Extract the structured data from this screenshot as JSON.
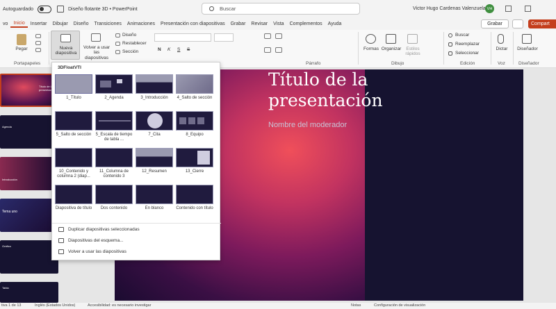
{
  "titlebar": {
    "autosave_label": "Autoguardado",
    "doc_name": "Diseño flotante 3D  •  PowerPoint",
    "search_placeholder": "Buscar",
    "user_name": "Victor Hugo Cardenas Valenzuela",
    "user_initials": "VH"
  },
  "tabs": [
    "vo",
    "Inicio",
    "Insertar",
    "Dibujar",
    "Diseño",
    "Transiciones",
    "Animaciones",
    "Presentación con diapositivas",
    "Grabar",
    "Revisar",
    "Vista",
    "Complementos",
    "Ayuda"
  ],
  "active_tab": "Inicio",
  "actions": {
    "record": "Grabar",
    "share": "Compart"
  },
  "ribbon": {
    "paste": "Pegar",
    "new_slide": "Nueva diapositiva",
    "reuse_slides": "Volver a usar las diapositivas",
    "design": "Diseño",
    "reset": "Restablecer",
    "section": "Sección",
    "shapes": "Formas",
    "arrange": "Organizar",
    "quick_styles": "Estilos rápidos",
    "find": "Buscar",
    "replace": "Reemplazar",
    "select": "Seleccionar",
    "dictate": "Dictar",
    "designer": "Diseñador",
    "groups": {
      "clipboard": "Portapapeles",
      "paragraph": "Párrafo",
      "drawing": "Dibujo",
      "editing": "Edición",
      "voice": "Voz",
      "designer": "Diseñador"
    },
    "font_buttons": {
      "bold": "N",
      "italic": "K",
      "underline": "S",
      "strike": "S"
    }
  },
  "dropdown": {
    "title": "3DFloatVTI",
    "layouts": [
      "1_Título",
      "2_Agenda",
      "3_Introducción",
      "4_Salto de sección",
      "5_Salto de sección",
      "5_Escala de tiempo de tabla ...",
      "7_Cita",
      "8_Equipo",
      "10_Contenido y columna 2 (diap...",
      "11_Columna de contenido 3",
      "12_Resumen",
      "13_Cierre",
      "Diapositiva de título",
      "Dos contenido",
      "En blanco",
      "Contenido con título"
    ],
    "menu": [
      "Duplicar diapositivas seleccionadas",
      "Diapositivas del esquema...",
      "Volver a usar las diapositivas"
    ]
  },
  "thumbnails": [
    {
      "label": "Título de la presentación"
    },
    {
      "label": "Agenda"
    },
    {
      "label": "Introducción"
    },
    {
      "label": "Tema uno"
    },
    {
      "label": "Gráfico"
    },
    {
      "label": "Tabla"
    }
  ],
  "slide": {
    "title": "Título de la presentación",
    "subtitle": "Nombre del moderador"
  },
  "statusbar": {
    "slide_count": "tiva 1 de 13",
    "language": "Inglés (Estados Unidos)",
    "accessibility": "Accesibilidad: es necesario investigar",
    "notes": "Notas",
    "display_settings": "Configuración de visualización"
  },
  "colors": {
    "accent": "#c43e1c",
    "slide_dark": "#161330"
  }
}
